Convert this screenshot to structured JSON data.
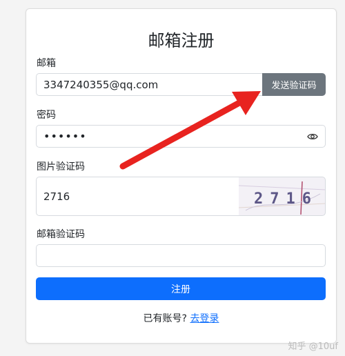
{
  "form": {
    "title": "邮箱注册",
    "email_label": "邮箱",
    "email_value": "3347240355@qq.com",
    "send_code_label": "发送验证码",
    "password_label": "密码",
    "password_value": "••••••",
    "image_captcha_label": "图片验证码",
    "image_captcha_value": "2716",
    "captcha_image_text": "2716",
    "email_code_label": "邮箱验证码",
    "email_code_value": "",
    "register_label": "注册",
    "footer_text": "已有账号?",
    "login_link": "去登录"
  },
  "watermark": "知乎 @10uf",
  "colors": {
    "primary": "#0d6efd",
    "secondary": "#6c757d",
    "arrow": "#e8231f"
  },
  "icons": {
    "eye": "eye-icon"
  }
}
